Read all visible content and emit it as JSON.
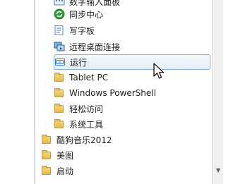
{
  "menu": {
    "items": [
      {
        "label": "数字输入面板",
        "icon": "input-panel-icon"
      },
      {
        "label": "同步中心",
        "icon": "sync-center-icon"
      },
      {
        "label": "写字板",
        "icon": "wordpad-icon"
      },
      {
        "label": "远程桌面连接",
        "icon": "remote-desktop-icon"
      },
      {
        "label": "运行",
        "icon": "run-icon",
        "selected": true
      },
      {
        "label": "Tablet PC",
        "icon": "folder-icon"
      },
      {
        "label": "Windows PowerShell",
        "icon": "folder-icon"
      },
      {
        "label": "轻松访问",
        "icon": "folder-icon"
      },
      {
        "label": "系统工具",
        "icon": "folder-icon"
      },
      {
        "label": "酷狗音乐2012",
        "icon": "folder-icon"
      },
      {
        "label": "美图",
        "icon": "folder-icon"
      },
      {
        "label": "启动",
        "icon": "folder-icon"
      }
    ]
  },
  "scrollbar": {
    "down_arrow": "▼"
  },
  "colors": {
    "selection_border": "#84acdd",
    "selection_fill": "#e3effa",
    "folder": "#e9b93f",
    "sync_green": "#2f9e38"
  }
}
